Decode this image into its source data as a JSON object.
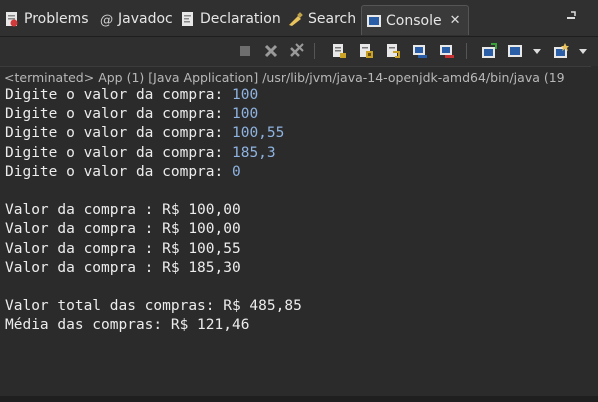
{
  "tabs": [
    {
      "label": "Problems",
      "icon": "problems-icon",
      "active": false
    },
    {
      "label": "Javadoc",
      "icon": "javadoc-icon",
      "active": false
    },
    {
      "label": "Declaration",
      "icon": "declaration-icon",
      "active": false
    },
    {
      "label": "Search",
      "icon": "search-icon",
      "active": false
    },
    {
      "label": "Console",
      "icon": "console-icon",
      "active": true
    }
  ],
  "tab_close": "✕",
  "toolbar": {
    "icons": [
      "terminate-icon",
      "remove-launch-icon",
      "remove-all-terminated-icon",
      "clear-console-icon",
      "scroll-lock-icon",
      "word-wrap-icon",
      "show-stdout-icon",
      "show-stderr-icon",
      "pin-console-icon",
      "display-selected-console-icon",
      "open-console-icon"
    ]
  },
  "console": {
    "status": "<terminated> App (1) [Java Application] /usr/lib/jvm/java-14-openjdk-amd64/bin/java  (19",
    "lines": [
      {
        "prompt": "Digite o valor da compra: ",
        "input": "100"
      },
      {
        "prompt": "Digite o valor da compra: ",
        "input": "100"
      },
      {
        "prompt": "Digite o valor da compra: ",
        "input": "100,55"
      },
      {
        "prompt": "Digite o valor da compra: ",
        "input": "185,3"
      },
      {
        "prompt": "Digite o valor da compra: ",
        "input": "0"
      },
      {
        "prompt": "",
        "input": ""
      },
      {
        "prompt": "Valor da compra : R$ 100,00",
        "input": ""
      },
      {
        "prompt": "Valor da compra : R$ 100,00",
        "input": ""
      },
      {
        "prompt": "Valor da compra : R$ 100,55",
        "input": ""
      },
      {
        "prompt": "Valor da compra : R$ 185,30",
        "input": ""
      },
      {
        "prompt": "",
        "input": ""
      },
      {
        "prompt": "Valor total das compras: R$ 485,85",
        "input": ""
      },
      {
        "prompt": "Média das compras: R$ 121,46",
        "input": ""
      }
    ]
  },
  "colors": {
    "background": "#2b2b2b",
    "text": "#ececec",
    "input_text": "#8fb3e0"
  }
}
